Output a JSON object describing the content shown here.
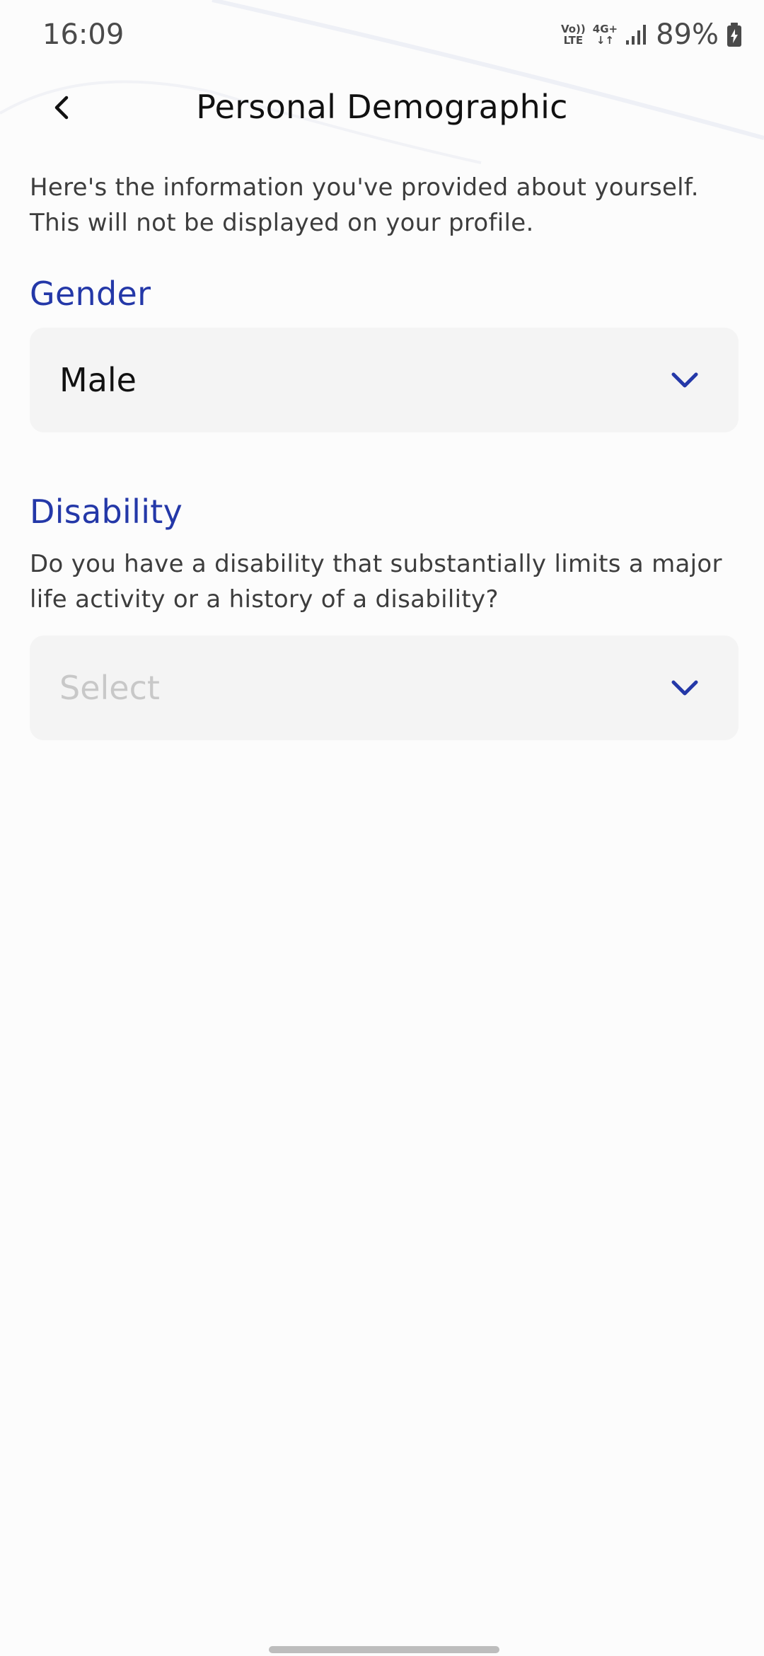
{
  "status_bar": {
    "time": "16:09",
    "volte_top": "Vo))",
    "volte_bottom": "LTE",
    "network_top": "4G+",
    "network_bottom": "↓↑",
    "battery": "89%"
  },
  "header": {
    "title": "Personal Demographic"
  },
  "intro_text": "Here's the information you've provided about yourself. This will not be displayed on your profile.",
  "gender": {
    "label": "Gender",
    "selected": "Male"
  },
  "disability": {
    "label": "Disability",
    "question": "Do you have a disability that substantially limits a major life activity or a history of a disability?",
    "placeholder": "Select"
  },
  "colors": {
    "accent": "#2438a8",
    "field_bg": "#f4f4f4",
    "placeholder": "#c8c8c8"
  },
  "icons": {
    "back": "chevron-left-icon",
    "dropdown": "chevron-down-icon",
    "signal": "signal-bars-icon",
    "battery": "battery-charging-icon"
  }
}
